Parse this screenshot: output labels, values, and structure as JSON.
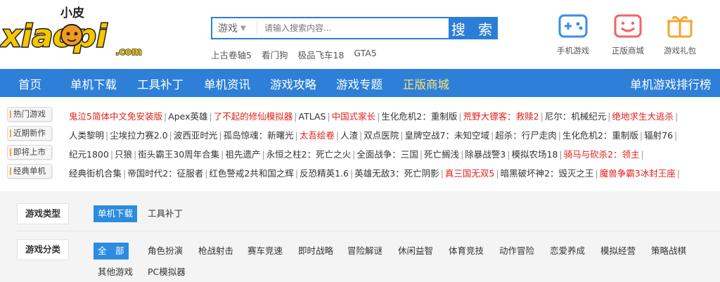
{
  "logo": {
    "text_top": "小皮",
    "text_main": "xiaopi",
    "text_sub": ".com"
  },
  "search": {
    "category": "游戏",
    "placeholder": "请输入搜索内容...",
    "button": "搜 索"
  },
  "hot_words": [
    "上古卷轴5",
    "看门狗",
    "极品飞车18",
    "GTA5"
  ],
  "quick_links": [
    {
      "label": "手机游戏",
      "icon": "gamepad-icon"
    },
    {
      "label": "正版商城",
      "icon": "smiley-bag-icon"
    },
    {
      "label": "游戏礼包",
      "icon": "gift-icon"
    }
  ],
  "nav": {
    "items": [
      "首页",
      "单机下载",
      "工具补丁",
      "单机资讯",
      "游戏攻略",
      "游戏专题",
      "正版商城"
    ],
    "right": "单机游戏排行榜"
  },
  "rows": [
    {
      "label": "热门游戏",
      "items": [
        {
          "t": "鬼泣5简体中文免安装版",
          "red": true
        },
        {
          "t": "Apex英雄",
          "red": false
        },
        {
          "t": "了不起的修仙模拟器",
          "red": true
        },
        {
          "t": "ATLAS",
          "red": false
        },
        {
          "t": "中国式家长",
          "red": true
        },
        {
          "t": "生化危机2：重制版",
          "red": false
        },
        {
          "t": "荒野大镖客：救赎2",
          "red": true
        },
        {
          "t": "尼尔：机械纪元",
          "red": false
        },
        {
          "t": "绝地求生大逃杀",
          "red": true
        }
      ]
    },
    {
      "label": "近期新作",
      "items": [
        {
          "t": "人类黎明",
          "red": false
        },
        {
          "t": "尘埃拉力赛2.0",
          "red": false
        },
        {
          "t": "波西亚时光",
          "red": false
        },
        {
          "t": "孤岛惊魂：新曙光",
          "red": false
        },
        {
          "t": "太吾绘卷",
          "red": true
        },
        {
          "t": "人渣",
          "red": false
        },
        {
          "t": "双点医院",
          "red": false
        },
        {
          "t": "皇牌空战7：未知空域",
          "red": false
        },
        {
          "t": "超杀：行尸走肉",
          "red": false
        },
        {
          "t": "生化危机2：重制版",
          "red": false
        },
        {
          "t": "辐射76",
          "red": false
        }
      ]
    },
    {
      "label": "即将上市",
      "items": [
        {
          "t": "纪元1800",
          "red": false
        },
        {
          "t": "只狼",
          "red": false
        },
        {
          "t": "街头霸王30周年合集",
          "red": false
        },
        {
          "t": "祖先遗产",
          "red": false
        },
        {
          "t": "永恒之柱2：死亡之火",
          "red": false
        },
        {
          "t": "全面战争：三国",
          "red": false
        },
        {
          "t": "死亡搁浅",
          "red": false
        },
        {
          "t": "除暴战警3",
          "red": false
        },
        {
          "t": "模拟农场18",
          "red": false
        },
        {
          "t": "骑马与砍杀2：领主",
          "red": true
        }
      ]
    },
    {
      "label": "经典单机",
      "items": [
        {
          "t": "经典街机合集",
          "red": false
        },
        {
          "t": "帝国时代2：征服者",
          "red": false
        },
        {
          "t": "红色警戒2共和国之辉",
          "red": false
        },
        {
          "t": "反恐精英1.6",
          "red": false
        },
        {
          "t": "英雄无敌3：死亡阴影",
          "red": false
        },
        {
          "t": "真三国无双5",
          "red": true
        },
        {
          "t": "暗黑破坏神2：毁灭之王",
          "red": false
        },
        {
          "t": "魔兽争霸3冰封王座",
          "red": true
        }
      ]
    }
  ],
  "filter": {
    "type_label": "游戏类型",
    "types": [
      "单机下载",
      "工具补丁"
    ],
    "cat_label": "游戏分类",
    "categories": [
      "全　部",
      "角色扮演",
      "枪战射击",
      "赛车竞速",
      "即时战略",
      "冒险解谜",
      "休闲益智",
      "体育竞技",
      "动作冒险",
      "恋爱养成",
      "模拟经营",
      "策略战棋"
    ],
    "categories_row2": [
      "其他游戏",
      "PC模拟器"
    ]
  },
  "colors": {
    "brand_blue": "#2d7fd8",
    "accent_red": "#e0201a",
    "mall_yellow": "#ffe27a",
    "logo_yellow": "#f7c600"
  }
}
